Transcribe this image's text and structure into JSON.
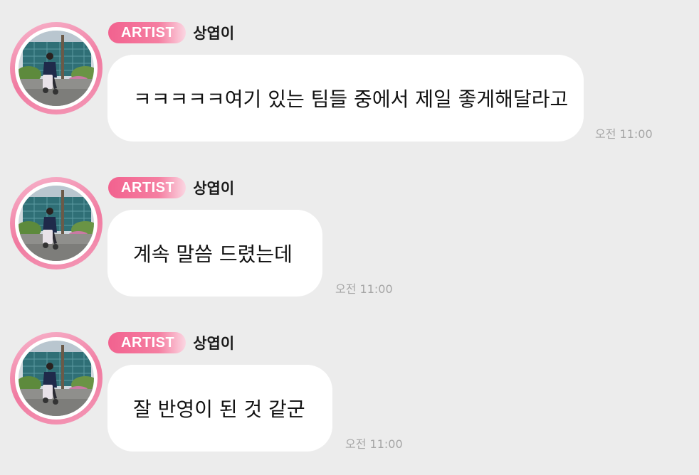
{
  "messages": [
    {
      "badge": "ARTIST",
      "sender": "상엽이",
      "text": "ㅋㅋㅋㅋㅋ여기 있는 팀들 중에서 제일 좋게해달라고",
      "time": "오전 11:00"
    },
    {
      "badge": "ARTIST",
      "sender": "상엽이",
      "text": "계속 말씀 드렸는데",
      "time": "오전 11:00"
    },
    {
      "badge": "ARTIST",
      "sender": "상엽이",
      "text": "잘 반영이 된 것 같군",
      "time": "오전 11:00"
    }
  ],
  "colors": {
    "background": "#ececec",
    "badge_pink": "#f2628f",
    "ring_pink": "#f07aa0",
    "bubble": "#ffffff",
    "timestamp": "#a6a6a6"
  }
}
